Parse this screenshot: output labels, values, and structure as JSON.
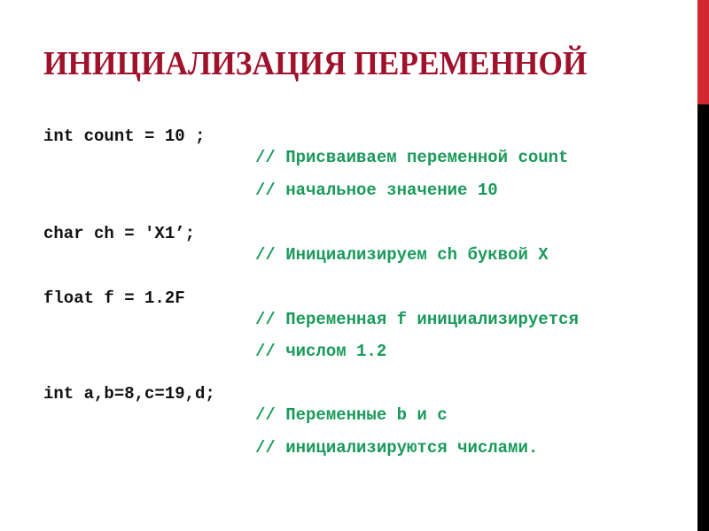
{
  "slide": {
    "title": "ИНИЦИАЛИЗАЦИЯ ПЕРЕМЕННОЙ",
    "colors": {
      "title": "#a0112b",
      "code": "#111111",
      "comment": "#1a9a5a",
      "accent_bar_top": "#d0282e",
      "accent_bar_bottom": "#000000"
    },
    "code_lines": [
      {
        "code": "int count = 10 ;",
        "comment": "// Присваиваем переменной count"
      },
      {
        "code": "",
        "comment": "// начальное значение 10"
      },
      {
        "code": "char ch = 'X1’;",
        "comment": "// Инициализируем ch буквой X"
      },
      {
        "code": "float f = 1.2F",
        "comment": "// Переменная f инициализируется"
      },
      {
        "code": "",
        "comment": "// числом 1.2"
      },
      {
        "code": "int a,b=8,c=19,d;",
        "comment": "// Переменные b и c"
      },
      {
        "code": "",
        "comment": "// инициализируются числами."
      }
    ]
  }
}
